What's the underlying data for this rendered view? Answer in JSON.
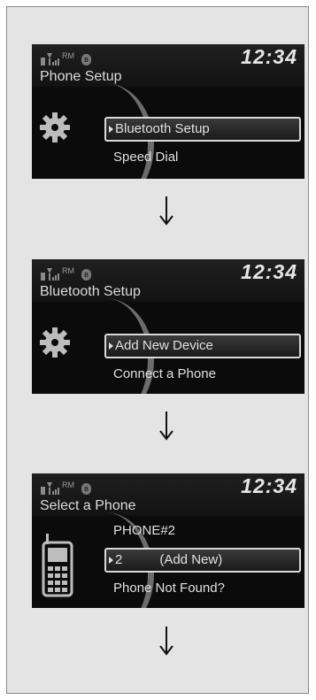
{
  "screens": [
    {
      "clock": "12:34",
      "title": "Phone Setup",
      "menu": [
        "Bluetooth Setup",
        "Speed Dial"
      ]
    },
    {
      "clock": "12:34",
      "title": "Bluetooth Setup",
      "menu": [
        "Add New Device",
        "Connect a Phone"
      ]
    },
    {
      "clock": "12:34",
      "title": "Select a Phone",
      "menu_top": "PHONE#2",
      "selected_index": "2",
      "selected_label": "(Add New)",
      "menu_bottom": "Phone Not Found?"
    }
  ],
  "status": {
    "roaming": "RM",
    "bluetooth_symbol": "ʙ"
  },
  "colors": {
    "screen_bg": "#0b0b0b",
    "panel_bg": "#e4e4e4",
    "text": "#e0e0e0"
  },
  "icons": [
    "signal-icon",
    "bluetooth-icon",
    "gear-icon",
    "cellphone-icon",
    "down-arrow-icon"
  ]
}
